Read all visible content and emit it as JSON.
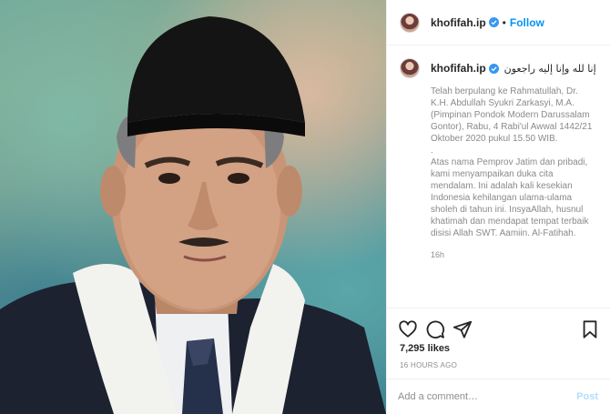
{
  "post": {
    "username": "khofifah.ip",
    "verified": true,
    "separator": "•",
    "follow_label": "Follow",
    "image_alt": "Portrait photo",
    "caption_title": "إنا لله وإنا إليه راجعون",
    "caption_para1": "Telah berpulang ke Rahmatullah, Dr. K.H. Abdullah Syukri Zarkasyi, M.A. (Pimpinan Pondok Modern Darussalam Gontor), Rabu, 4 Rabi'ul Awwal 1442/21 Oktober 2020 pukul 15.50 WIB.",
    "caption_para2": ".",
    "caption_para3": "Atas nama Pemprov Jatim dan pribadi, kami menyampaikan duka cita mendalam. Ini adalah kali kesekian Indonesia kehilangan ulama-ulama sholeh di tahun ini. InsyaAllah, husnul khatimah dan mendapat tempat terbaik disisi Allah SWT. Aamiin. Al-Fatihah.",
    "caption_time": "16h",
    "likes": "7,295 likes",
    "time_ago": "16 HOURS AGO",
    "comment_placeholder": "Add a comment…",
    "post_label": "Post"
  },
  "icons": {
    "like": "heart-icon",
    "comment": "comment-icon",
    "share": "share-icon",
    "save": "bookmark-icon",
    "verified": "verified-badge-icon"
  },
  "colors": {
    "link_blue": "#0095f6",
    "post_disabled": "#b2dffc",
    "verified_blue": "#3897f0"
  }
}
